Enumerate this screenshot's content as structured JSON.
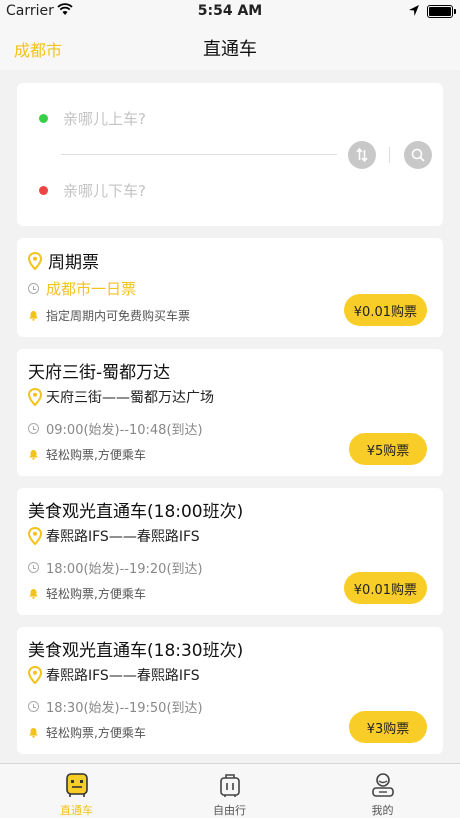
{
  "status_bar": {
    "carrier": "Carrier",
    "time": "5:54 AM"
  },
  "nav": {
    "city": "成都市",
    "title": "直通车"
  },
  "search": {
    "from_placeholder": "亲哪儿上车?",
    "to_placeholder": "亲哪儿下车?",
    "swap_icon": "swap-icon",
    "search_icon": "search-icon"
  },
  "colors": {
    "accent": "#f9cd27",
    "accent_text": "#f2c31b",
    "green": "#35d048",
    "red": "#ee4444"
  },
  "period_card": {
    "title": "周期票",
    "subtitle": "成都市一日票",
    "note": "指定周期内可免费购买车票",
    "button": "¥0.01购票"
  },
  "routes": [
    {
      "title": "天府三街-蜀都万达",
      "route": "天府三街——蜀都万达广场",
      "time": "09:00(始发)--10:48(到达)",
      "note": "轻松购票,方便乘车",
      "button": "¥5购票"
    },
    {
      "title": "美食观光直通车(18:00班次)",
      "route": "春熙路IFS——春熙路IFS",
      "time": "18:00(始发)--19:20(到达)",
      "note": "轻松购票,方便乘车",
      "button": "¥0.01购票"
    },
    {
      "title": "美食观光直通车(18:30班次)",
      "route": "春熙路IFS——春熙路IFS",
      "time": "18:30(始发)--19:50(到达)",
      "note": "轻松购票,方便乘车",
      "button": "¥3购票"
    }
  ],
  "tabs": [
    {
      "label": "直通车",
      "icon": "bus-icon",
      "active": true
    },
    {
      "label": "自由行",
      "icon": "luggage-icon",
      "active": false
    },
    {
      "label": "我的",
      "icon": "user-icon",
      "active": false
    }
  ]
}
